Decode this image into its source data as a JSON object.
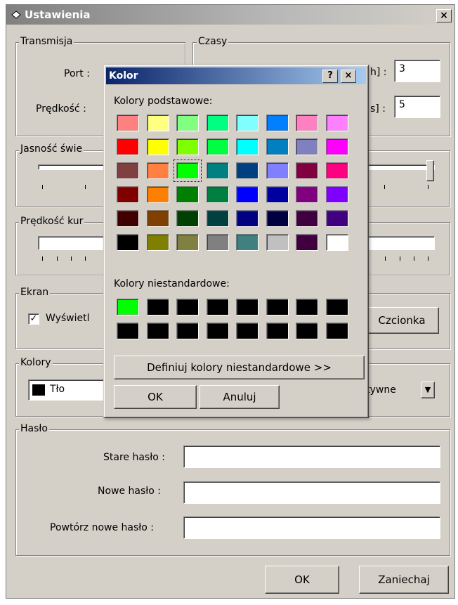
{
  "window": {
    "title": "Ustawienia",
    "close_label": "×"
  },
  "transmisja": {
    "legend": "Transmisja",
    "port_label": "Port :",
    "speed_label": "Prędkość :"
  },
  "czasy": {
    "legend": "Czasy",
    "label1_suffix": "h] :",
    "value1": "3",
    "label2_suffix": "s] :",
    "value2": "5"
  },
  "jasnosc": {
    "legend": "Jasność świe",
    "slider_value_fraction": 0.98
  },
  "predkosc_kursora": {
    "legend": "Prędkość kur"
  },
  "ekran": {
    "legend": "Ekran",
    "checkbox_label": "Wyświetl",
    "checked": true,
    "font_button": "Czcionka"
  },
  "kolory": {
    "legend": "Kolory",
    "color_label": "Tło",
    "color_value": "#000000",
    "dropdown_value": "ktywne"
  },
  "haslo": {
    "legend": "Hasło",
    "old_label": "Stare hasło :",
    "new_label": "Nowe hasło :",
    "repeat_label": "Powtórz nowe hasło :"
  },
  "buttons": {
    "ok": "OK",
    "cancel": "Zaniechaj"
  },
  "color_dialog": {
    "title": "Kolor",
    "help_label": "?",
    "close_label": "×",
    "basic_label": "Kolory podstawowe:",
    "custom_label": "Kolory niestandardowe:",
    "define_button": "Definiuj kolory niestandardowe >>",
    "ok_button": "OK",
    "cancel_button": "Anuluj",
    "selected_index": 18,
    "basic_colors": [
      "#ff8080",
      "#ffff80",
      "#80ff80",
      "#00ff80",
      "#80ffff",
      "#0080ff",
      "#ff80c0",
      "#ff80ff",
      "#ff0000",
      "#ffff00",
      "#80ff00",
      "#00ff40",
      "#00ffff",
      "#0080c0",
      "#8080c0",
      "#ff00ff",
      "#804040",
      "#ff8040",
      "#00ff00",
      "#008080",
      "#004080",
      "#8080ff",
      "#800040",
      "#ff0080",
      "#800000",
      "#ff8000",
      "#008000",
      "#008040",
      "#0000ff",
      "#0000a0",
      "#800080",
      "#8000ff",
      "#400000",
      "#804000",
      "#004000",
      "#004040",
      "#000080",
      "#000040",
      "#400040",
      "#400080",
      "#000000",
      "#808000",
      "#808040",
      "#808080",
      "#408080",
      "#c0c0c0",
      "#400040",
      "#ffffff"
    ],
    "custom_colors": [
      "#00ff00",
      "#000000",
      "#000000",
      "#000000",
      "#000000",
      "#000000",
      "#000000",
      "#000000",
      "#000000",
      "#000000",
      "#000000",
      "#000000",
      "#000000",
      "#000000",
      "#000000",
      "#000000"
    ]
  }
}
